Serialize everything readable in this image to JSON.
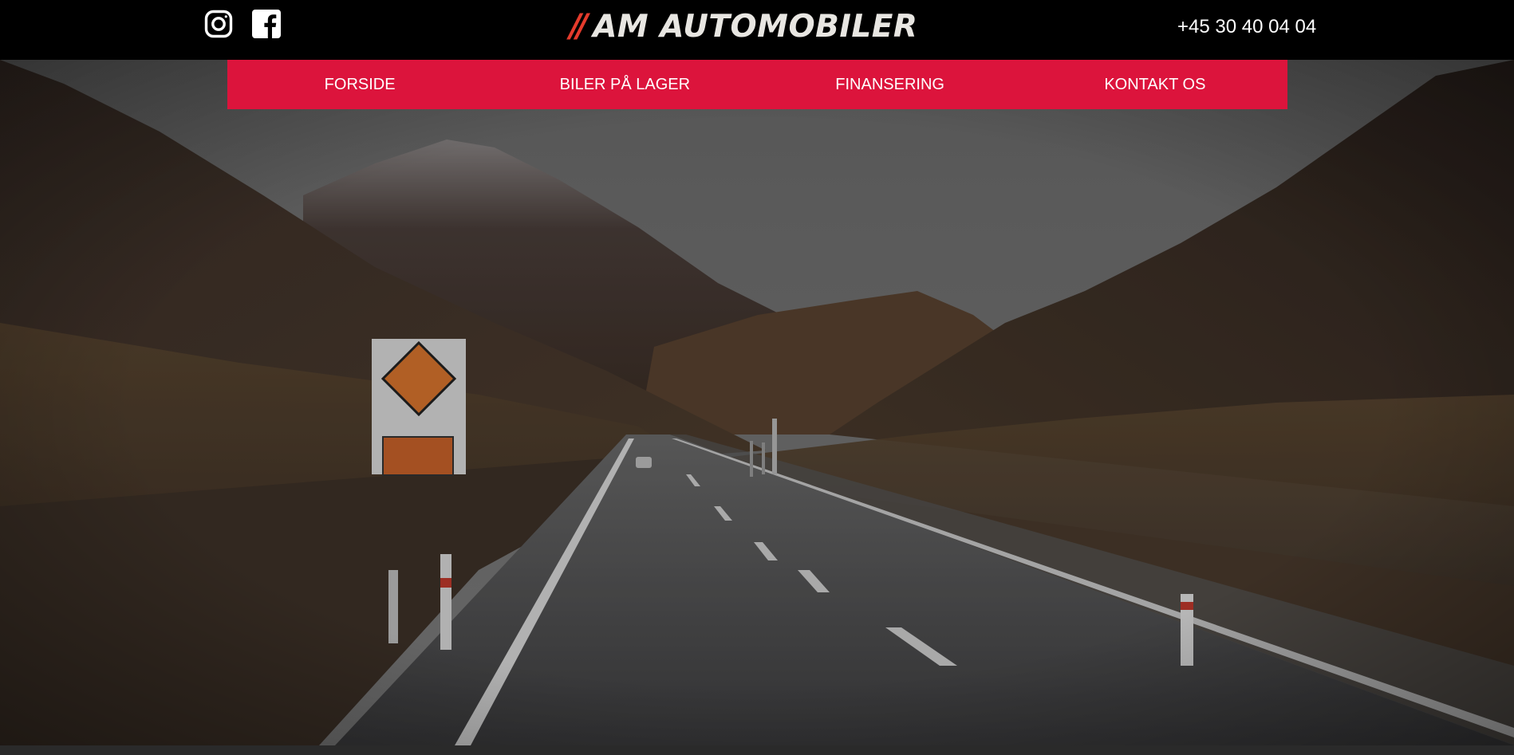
{
  "header": {
    "logo_mark": "//",
    "logo_text": "AM AUTOMOBILER",
    "phone": "+45 30 40 04 04",
    "social": [
      {
        "icon": "instagram-icon"
      },
      {
        "icon": "facebook-icon"
      }
    ]
  },
  "nav": {
    "items": [
      {
        "label": "FORSIDE"
      },
      {
        "label": "BILER PÅ LAGER"
      },
      {
        "label": "FINANSERING"
      },
      {
        "label": "KONTAKT OS"
      }
    ]
  },
  "colors": {
    "nav_background": "#dc143c",
    "logo_accent": "#e53b2c",
    "topbar_background": "#000000"
  }
}
